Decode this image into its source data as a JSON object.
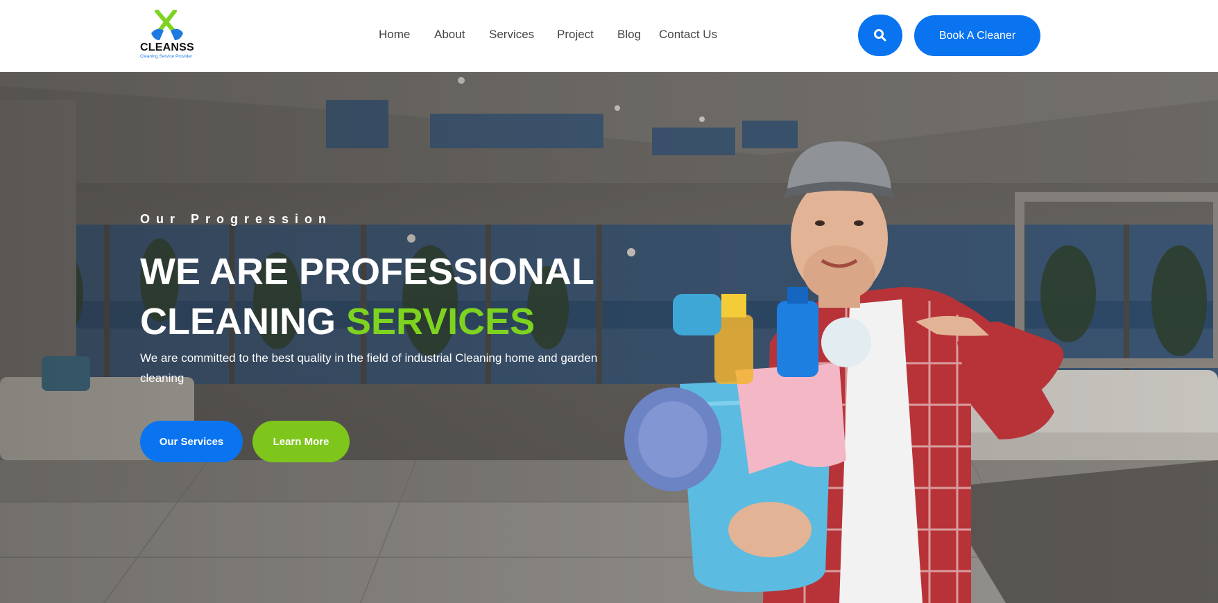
{
  "brand": {
    "name": "CLEANSS",
    "tagline": "Cleaning Service Provider",
    "colors": {
      "primary": "#0a74f0",
      "accent": "#7ed321",
      "text": "#444444"
    }
  },
  "nav": {
    "items": [
      {
        "label": "Home"
      },
      {
        "label": "About"
      },
      {
        "label": "Services"
      },
      {
        "label": "Project"
      },
      {
        "label": "Blog"
      },
      {
        "label": "Contact Us"
      }
    ]
  },
  "header": {
    "search_icon": "search-icon",
    "cta_label": "Book A Cleaner"
  },
  "hero": {
    "eyebrow": "Our Progression",
    "headline_line1": "WE ARE PROFESSIONAL",
    "headline_line2_prefix": "CLEANING ",
    "headline_line2_accent": "SERVICES",
    "description": "We are committed to the best quality in the field of industrial Cleaning home and garden cleaning",
    "primary_button": "Our Services",
    "secondary_button": "Learn More"
  }
}
